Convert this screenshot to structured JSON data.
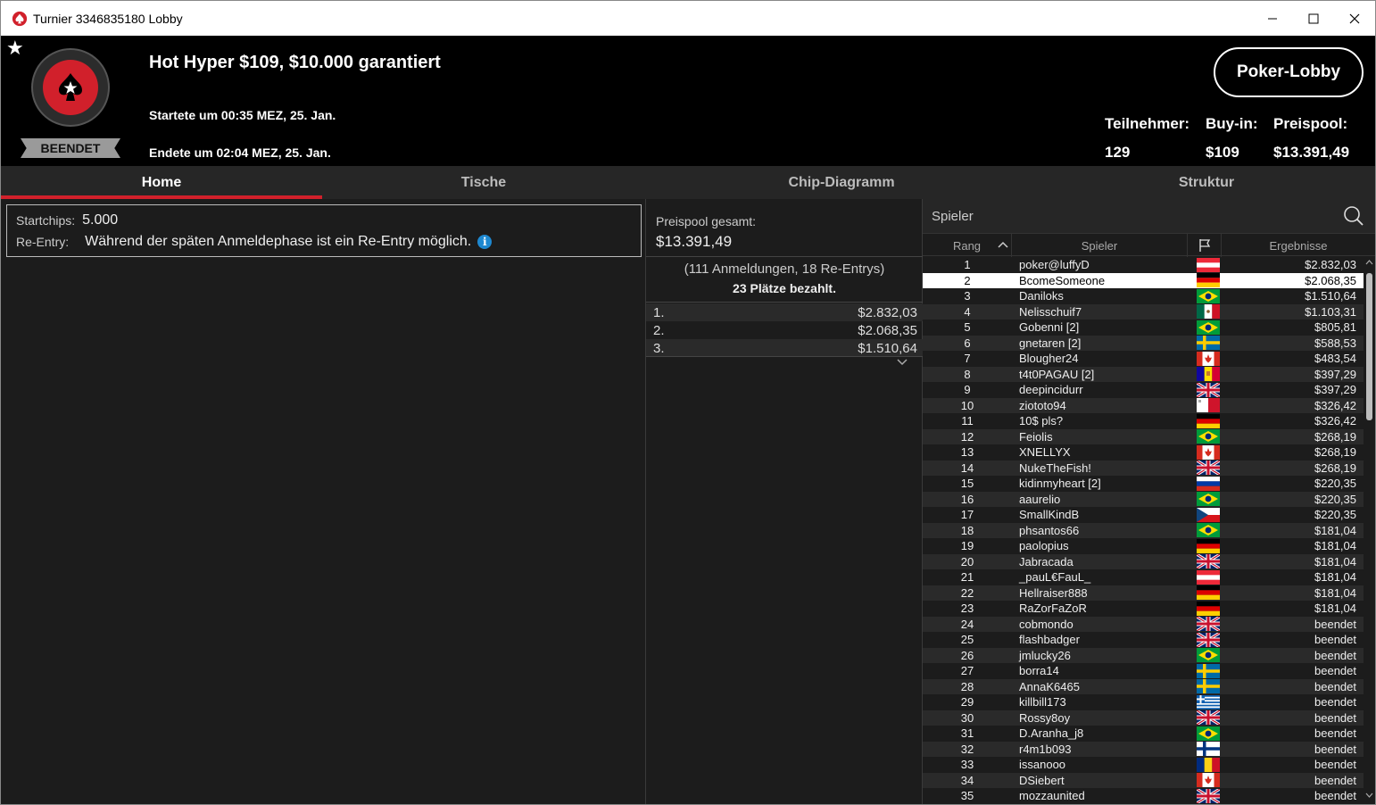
{
  "window": {
    "title": "Turnier 3346835180 Lobby",
    "app_icon": "pokerstars-spade-icon"
  },
  "header": {
    "tourney_title": "Hot Hyper $109, $10.000 garantiert",
    "start_time": "Startete um 00:35 MEZ, 25. Jan.",
    "end_time": "Endete um 02:04 MEZ, 25. Jan.",
    "status_badge": "BEENDET",
    "lobby_button": "Poker-Lobby",
    "stats": {
      "players_label": "Teilnehmer:",
      "players_value": "129",
      "buyin_label": "Buy-in:",
      "buyin_value": "$109",
      "prizepool_label": "Preispool:",
      "prizepool_value": "$13.391,49"
    },
    "accent_color": "#d1202b"
  },
  "tabs": [
    {
      "label": "Home",
      "active": true
    },
    {
      "label": "Tische",
      "active": false
    },
    {
      "label": "Chip-Diagramm",
      "active": false
    },
    {
      "label": "Struktur",
      "active": false
    }
  ],
  "info": {
    "startchips_label": "Startchips:",
    "startchips_value": "5.000",
    "reentry_label": "Re-Entry:",
    "reentry_value": "Während der späten Anmeldephase ist ein Re-Entry möglich."
  },
  "prizepool": {
    "label": "Preispool gesamt:",
    "total": "$13.391,49",
    "entries": "(111 Anmeldungen, 18 Re-Entrys)",
    "paid": "23 Plätze bezahlt.",
    "payouts": [
      {
        "place": "1.",
        "amount": "$2.832,03"
      },
      {
        "place": "2.",
        "amount": "$2.068,35"
      },
      {
        "place": "3.",
        "amount": "$1.510,64"
      }
    ]
  },
  "players": {
    "search_label": "Spieler",
    "columns": {
      "rank": "Rang",
      "player": "Spieler",
      "result": "Ergebnisse"
    },
    "selected_rank": "2",
    "rows": [
      {
        "rank": "1",
        "name": "poker@luffyD",
        "flag": "at",
        "result": "$2.832,03"
      },
      {
        "rank": "2",
        "name": "BcomeSomeone",
        "flag": "de",
        "result": "$2.068,35"
      },
      {
        "rank": "3",
        "name": "Daniloks",
        "flag": "br",
        "result": "$1.510,64"
      },
      {
        "rank": "4",
        "name": "Nelisschuif7",
        "flag": "mx",
        "result": "$1.103,31"
      },
      {
        "rank": "5",
        "name": "Gobenni [2]",
        "flag": "br",
        "result": "$805,81"
      },
      {
        "rank": "6",
        "name": "gnetaren [2]",
        "flag": "se",
        "result": "$588,53"
      },
      {
        "rank": "7",
        "name": "Blougher24",
        "flag": "ca",
        "result": "$483,54"
      },
      {
        "rank": "8",
        "name": "t4t0PAGAU [2]",
        "flag": "ad",
        "result": "$397,29"
      },
      {
        "rank": "9",
        "name": "deepincidurr",
        "flag": "gb",
        "result": "$397,29"
      },
      {
        "rank": "10",
        "name": "ziototo94",
        "flag": "mt",
        "result": "$326,42"
      },
      {
        "rank": "11",
        "name": "10$ pls?",
        "flag": "de",
        "result": "$326,42"
      },
      {
        "rank": "12",
        "name": "Feiolis",
        "flag": "br",
        "result": "$268,19"
      },
      {
        "rank": "13",
        "name": "XNELLYX",
        "flag": "ca",
        "result": "$268,19"
      },
      {
        "rank": "14",
        "name": "NukeTheFish!",
        "flag": "gb",
        "result": "$268,19"
      },
      {
        "rank": "15",
        "name": "kidinmyheart [2]",
        "flag": "ru",
        "result": "$220,35"
      },
      {
        "rank": "16",
        "name": "aaurelio",
        "flag": "br",
        "result": "$220,35"
      },
      {
        "rank": "17",
        "name": "SmallKindB",
        "flag": "cz",
        "result": "$220,35"
      },
      {
        "rank": "18",
        "name": "phsantos66",
        "flag": "br",
        "result": "$181,04"
      },
      {
        "rank": "19",
        "name": "paolopius",
        "flag": "de",
        "result": "$181,04"
      },
      {
        "rank": "20",
        "name": "Jabracada",
        "flag": "gb",
        "result": "$181,04"
      },
      {
        "rank": "21",
        "name": "_pauL€FauL_",
        "flag": "at",
        "result": "$181,04"
      },
      {
        "rank": "22",
        "name": "Hellraiser888",
        "flag": "de",
        "result": "$181,04"
      },
      {
        "rank": "23",
        "name": "RaZorFaZoR",
        "flag": "de",
        "result": "$181,04"
      },
      {
        "rank": "24",
        "name": "cobmondo",
        "flag": "gb",
        "result": "beendet"
      },
      {
        "rank": "25",
        "name": "flashbadger",
        "flag": "gb",
        "result": "beendet"
      },
      {
        "rank": "26",
        "name": "jmlucky26",
        "flag": "br",
        "result": "beendet"
      },
      {
        "rank": "27",
        "name": "borra14",
        "flag": "se",
        "result": "beendet"
      },
      {
        "rank": "28",
        "name": "AnnaK6465",
        "flag": "se",
        "result": "beendet"
      },
      {
        "rank": "29",
        "name": "killbill173",
        "flag": "gr",
        "result": "beendet"
      },
      {
        "rank": "30",
        "name": "Rossy8oy",
        "flag": "gb",
        "result": "beendet"
      },
      {
        "rank": "31",
        "name": "D.Aranha_j8",
        "flag": "br",
        "result": "beendet"
      },
      {
        "rank": "32",
        "name": "r4m1b093",
        "flag": "fi",
        "result": "beendet"
      },
      {
        "rank": "33",
        "name": "issanooo",
        "flag": "ro",
        "result": "beendet"
      },
      {
        "rank": "34",
        "name": "DSiebert",
        "flag": "ca",
        "result": "beendet"
      },
      {
        "rank": "35",
        "name": "mozzaunited",
        "flag": "gb",
        "result": "beendet"
      }
    ]
  }
}
